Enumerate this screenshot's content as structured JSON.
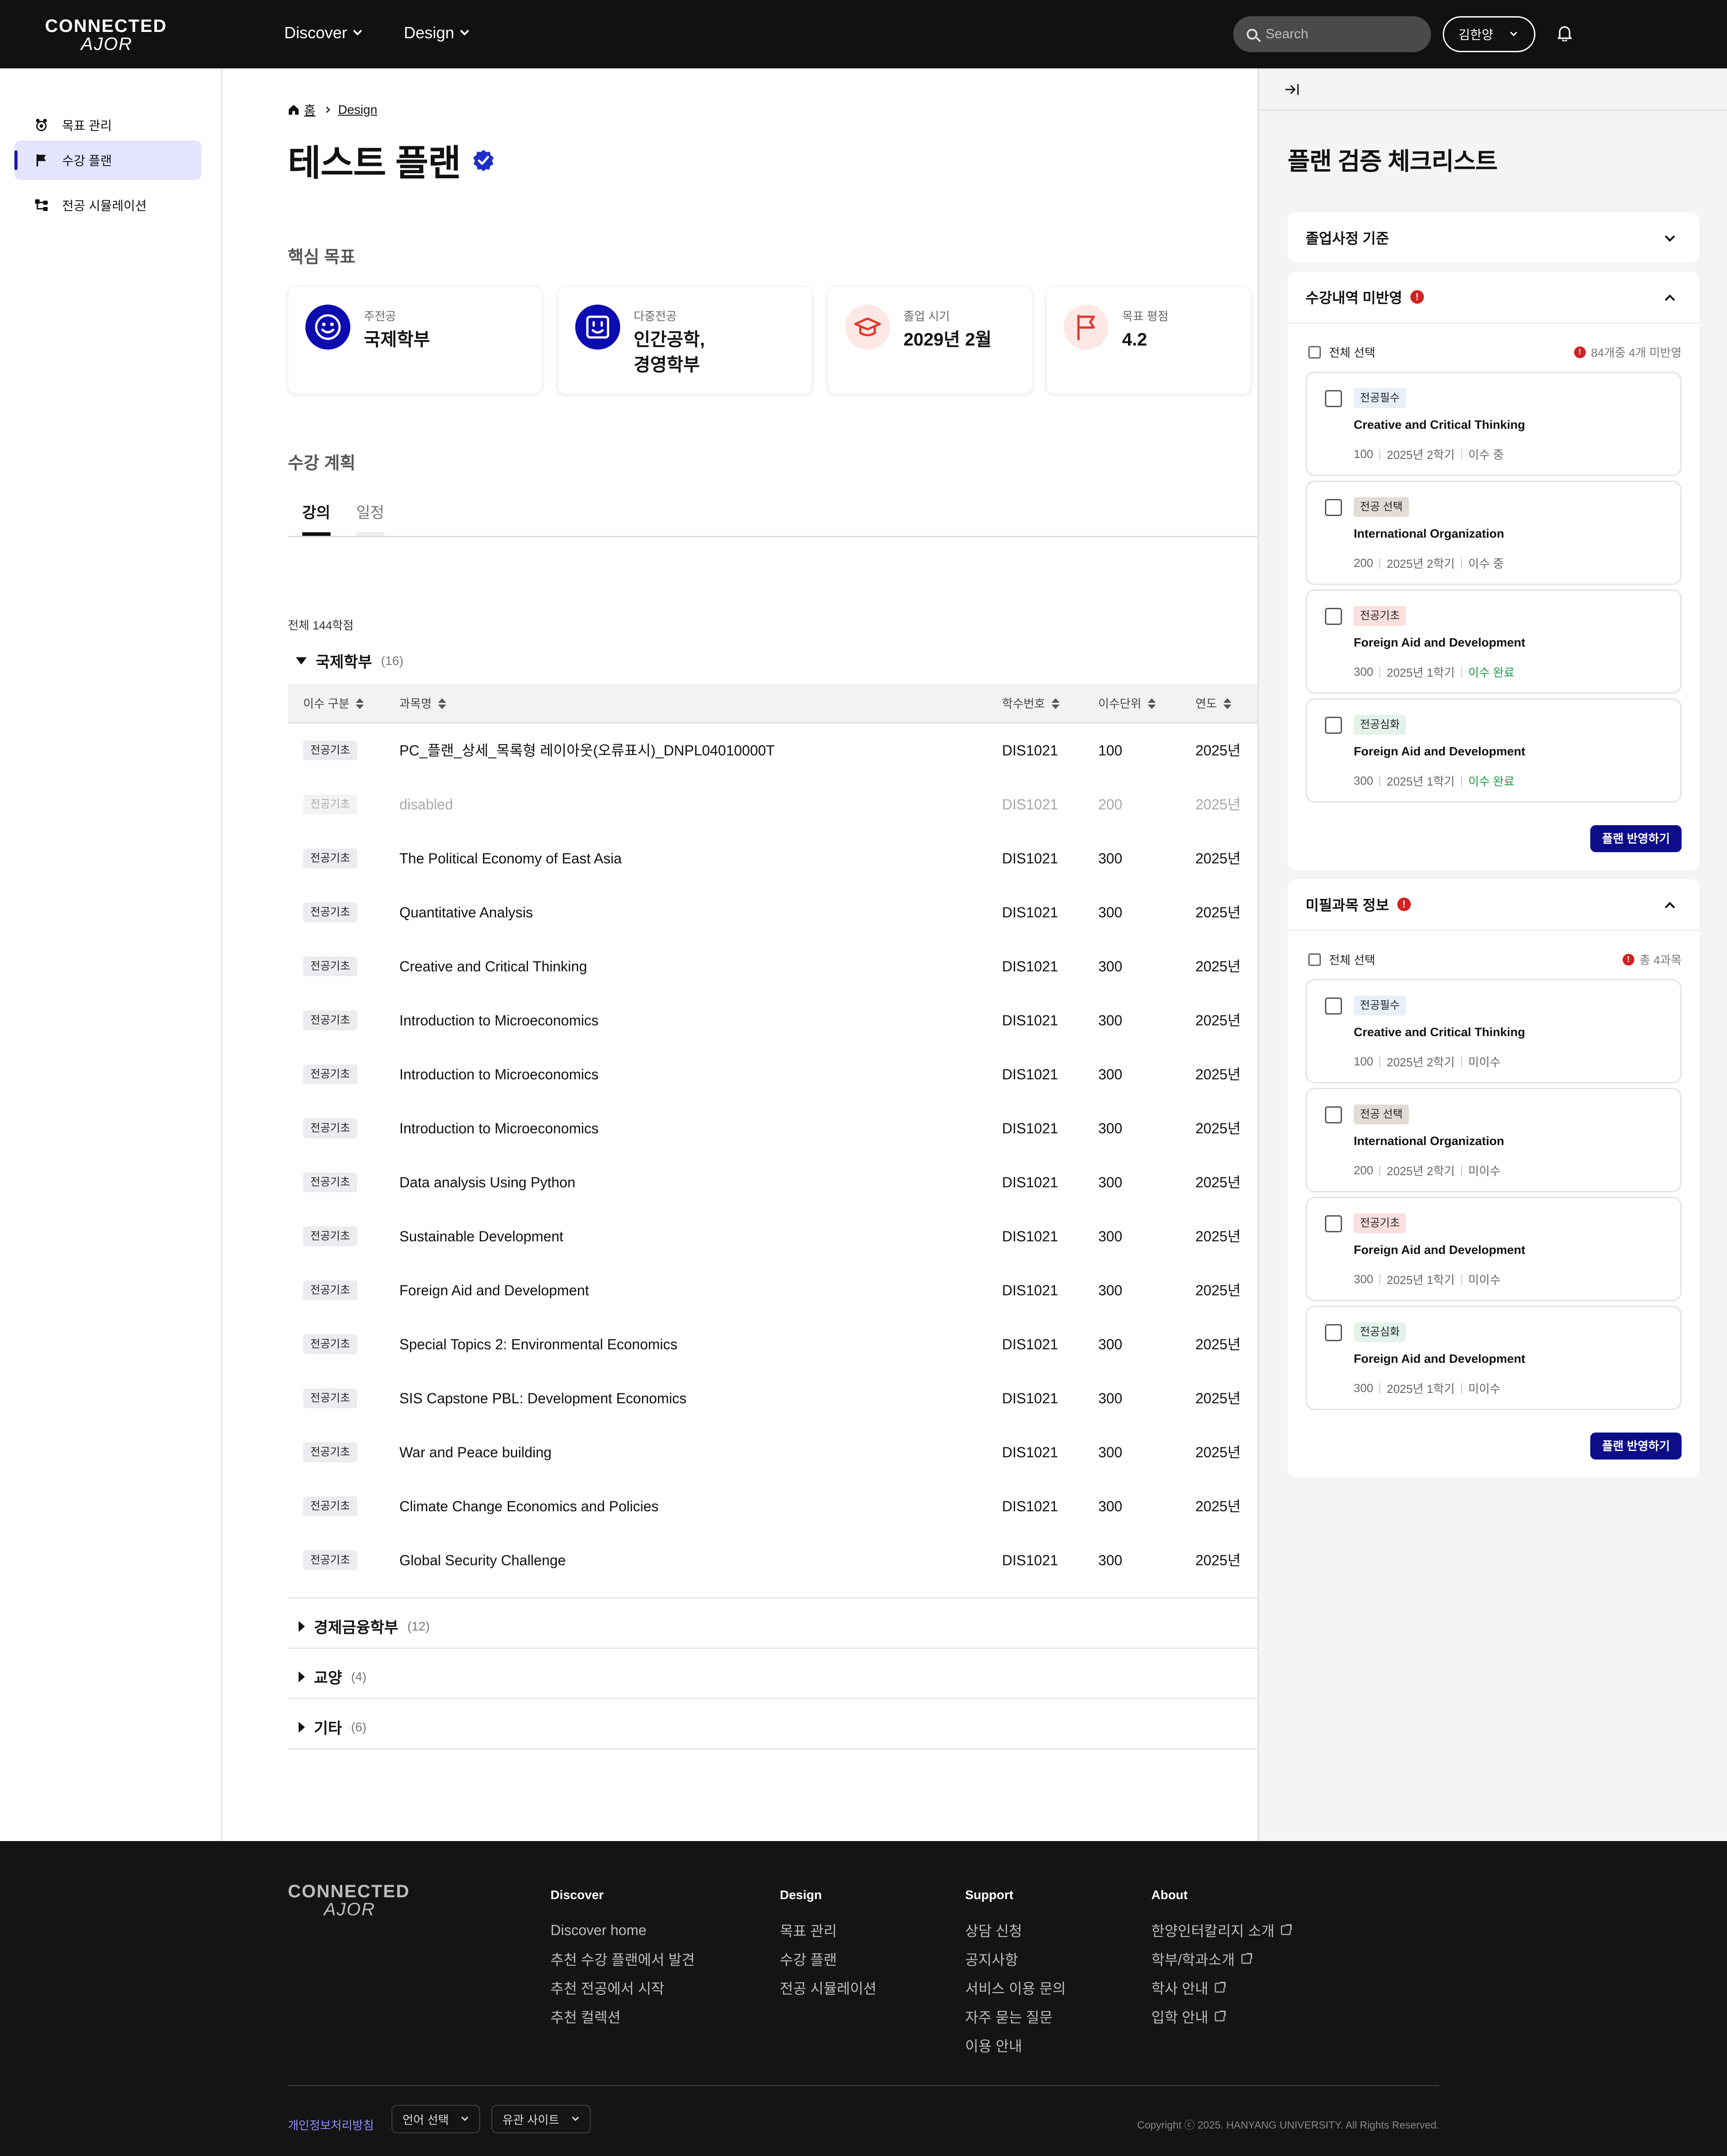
{
  "header": {
    "logo_line1": "CONNECTED",
    "logo_line2": "AJOR",
    "nav": [
      {
        "label": "Discover"
      },
      {
        "label": "Design"
      }
    ],
    "search_placeholder": "Search",
    "user_name": "김한양"
  },
  "sidebar": {
    "items": [
      {
        "label": "목표 관리",
        "icon": "goal-icon"
      },
      {
        "label": "수강 플랜",
        "icon": "flag-icon",
        "active": true
      },
      {
        "label": "전공 시뮬레이션",
        "icon": "tree-icon"
      }
    ]
  },
  "breadcrumb": {
    "home": "홈",
    "current": "Design"
  },
  "page": {
    "title": "테스트 플랜",
    "core_goal_title": "핵심 목표",
    "plan_title": "수강 계획"
  },
  "goals": [
    {
      "label": "주전공",
      "value": "국제학부",
      "icon": "smile-face-icon",
      "color": "#0b0bb0"
    },
    {
      "label": "다중전공",
      "value": "인간공학,\n경영학부",
      "icon": "square-face-icon",
      "color": "#0b0bb0"
    },
    {
      "label": "졸업 시기",
      "value": "2029년 2월",
      "icon": "graduation-cap-icon",
      "color": "#e23a2a"
    },
    {
      "label": "목표 평점",
      "value": "4.2",
      "icon": "flag-outline-icon",
      "color": "#e23a2a"
    }
  ],
  "tabs": [
    {
      "label": "강의",
      "active": true
    },
    {
      "label": "일정",
      "active": false
    }
  ],
  "total_credits": "전체 144학점",
  "columns": [
    "이수 구분",
    "과목명",
    "학수번호",
    "이수단위",
    "연도"
  ],
  "groups": [
    {
      "name": "국제학부",
      "count": "(16)",
      "expanded": true,
      "rows": [
        {
          "type": "전공기초",
          "name": "PC_플랜_상세_목록형 레이아웃(오류표시)_DNPL04010000T",
          "code": "DIS1021",
          "unit": "100",
          "year": "2025년"
        },
        {
          "type": "전공기초",
          "name": "disabled",
          "code": "DIS1021",
          "unit": "200",
          "year": "2025년",
          "disabled": true
        },
        {
          "type": "전공기초",
          "name": "The Political Economy of East Asia",
          "code": "DIS1021",
          "unit": "300",
          "year": "2025년"
        },
        {
          "type": "전공기초",
          "name": "Quantitative Analysis",
          "code": "DIS1021",
          "unit": "300",
          "year": "2025년"
        },
        {
          "type": "전공기초",
          "name": "Creative and Critical Thinking",
          "code": "DIS1021",
          "unit": "300",
          "year": "2025년"
        },
        {
          "type": "전공기초",
          "name": "Introduction to Microeconomics",
          "code": "DIS1021",
          "unit": "300",
          "year": "2025년"
        },
        {
          "type": "전공기초",
          "name": "Introduction to Microeconomics",
          "code": "DIS1021",
          "unit": "300",
          "year": "2025년"
        },
        {
          "type": "전공기초",
          "name": "Introduction to Microeconomics",
          "code": "DIS1021",
          "unit": "300",
          "year": "2025년"
        },
        {
          "type": "전공기초",
          "name": "Data analysis Using Python",
          "code": "DIS1021",
          "unit": "300",
          "year": "2025년"
        },
        {
          "type": "전공기초",
          "name": "Sustainable Development",
          "code": "DIS1021",
          "unit": "300",
          "year": "2025년"
        },
        {
          "type": "전공기초",
          "name": "Foreign Aid and Development",
          "code": "DIS1021",
          "unit": "300",
          "year": "2025년"
        },
        {
          "type": "전공기초",
          "name": "Special Topics 2: Environmental Economics",
          "code": "DIS1021",
          "unit": "300",
          "year": "2025년"
        },
        {
          "type": "전공기초",
          "name": "SIS Capstone PBL: Development Economics",
          "code": "DIS1021",
          "unit": "300",
          "year": "2025년"
        },
        {
          "type": "전공기초",
          "name": "War and Peace building",
          "code": "DIS1021",
          "unit": "300",
          "year": "2025년"
        },
        {
          "type": "전공기초",
          "name": "Climate Change Economics and Policies",
          "code": "DIS1021",
          "unit": "300",
          "year": "2025년"
        },
        {
          "type": "전공기초",
          "name": "Global Security Challenge",
          "code": "DIS1021",
          "unit": "300",
          "year": "2025년"
        }
      ]
    },
    {
      "name": "경제금융학부",
      "count": "(12)",
      "expanded": false
    },
    {
      "name": "교양",
      "count": "(4)",
      "expanded": false
    },
    {
      "name": "기타",
      "count": "(6)",
      "expanded": false
    }
  ],
  "panel": {
    "title": "플랜 검증 체크리스트",
    "sections": [
      {
        "title": "졸업사정 기준",
        "expanded": false,
        "alert": false
      },
      {
        "title": "수강내역 미반영",
        "expanded": true,
        "alert": true,
        "select_all": "전체 선택",
        "warning": "84개중 4개 미반영",
        "apply_label": "플랜 반영하기",
        "cards": [
          {
            "tag": "전공필수",
            "tag_color": "#e6effa",
            "name": "Creative and Critical Thinking",
            "unit": "100",
            "term": "2025년 2학기",
            "status": "이수 중",
            "done": false
          },
          {
            "tag": "전공 선택",
            "tag_color": "#e2dcd8",
            "name": "International Organization",
            "unit": "200",
            "term": "2025년 2학기",
            "status": "이수 중",
            "done": false
          },
          {
            "tag": "전공기초",
            "tag_color": "#fbdede",
            "name": "Foreign Aid and Development",
            "unit": "300",
            "term": "2025년 1학기",
            "status": "이수 완료",
            "done": true
          },
          {
            "tag": "전공심화",
            "tag_color": "#e4f3ea",
            "name": "Foreign Aid and Development",
            "unit": "300",
            "term": "2025년 1학기",
            "status": "이수 완료",
            "done": true
          }
        ]
      },
      {
        "title": "미필과목 정보",
        "expanded": true,
        "alert": true,
        "select_all": "전체 선택",
        "warning": "총 4과목",
        "apply_label": "플랜 반영하기",
        "cards": [
          {
            "tag": "전공필수",
            "tag_color": "#e6effa",
            "name": "Creative and Critical Thinking",
            "unit": "100",
            "term": "2025년 2학기",
            "status": "미이수",
            "done": false
          },
          {
            "tag": "전공 선택",
            "tag_color": "#e2dcd8",
            "name": "International Organization",
            "unit": "200",
            "term": "2025년 2학기",
            "status": "미이수",
            "done": false
          },
          {
            "tag": "전공기초",
            "tag_color": "#fbdede",
            "name": "Foreign Aid and Development",
            "unit": "300",
            "term": "2025년 1학기",
            "status": "미이수",
            "done": false
          },
          {
            "tag": "전공심화",
            "tag_color": "#e4f3ea",
            "name": "Foreign Aid and Development",
            "unit": "300",
            "term": "2025년 1학기",
            "status": "미이수",
            "done": false
          }
        ]
      }
    ]
  },
  "footer": {
    "columns": [
      {
        "title": "Discover",
        "links": [
          {
            "label": "Discover home"
          },
          {
            "label": "추천 수강 플랜에서 발견"
          },
          {
            "label": "추천 전공에서 시작"
          },
          {
            "label": "추천 컬렉션"
          }
        ]
      },
      {
        "title": "Design",
        "links": [
          {
            "label": "목표 관리"
          },
          {
            "label": "수강 플랜"
          },
          {
            "label": "전공 시뮬레이션"
          }
        ]
      },
      {
        "title": "Support",
        "links": [
          {
            "label": "상담 신청"
          },
          {
            "label": "공지사항"
          },
          {
            "label": "서비스 이용 문의"
          },
          {
            "label": "자주 묻는 질문"
          },
          {
            "label": "이용 안내"
          }
        ]
      },
      {
        "title": "About",
        "links": [
          {
            "label": "한양인터칼리지 소개",
            "external": true
          },
          {
            "label": "학부/학과소개",
            "external": true
          },
          {
            "label": "학사 안내",
            "external": true
          },
          {
            "label": "입학 안내",
            "external": true
          }
        ]
      }
    ],
    "privacy": "개인정보처리방침",
    "language_select": "언어 선택",
    "related_sites": "유관 사이트",
    "copyright": "Copyright ⓒ 2025. HANYANG UNIVERSITY. All Rights Reserved."
  },
  "colors": {
    "accent": "#0d0d8a",
    "header_bg": "#111111",
    "sidebar_active_bg": "#e4e4ff",
    "alert": "#d32020",
    "done": "#1c9a4a"
  }
}
